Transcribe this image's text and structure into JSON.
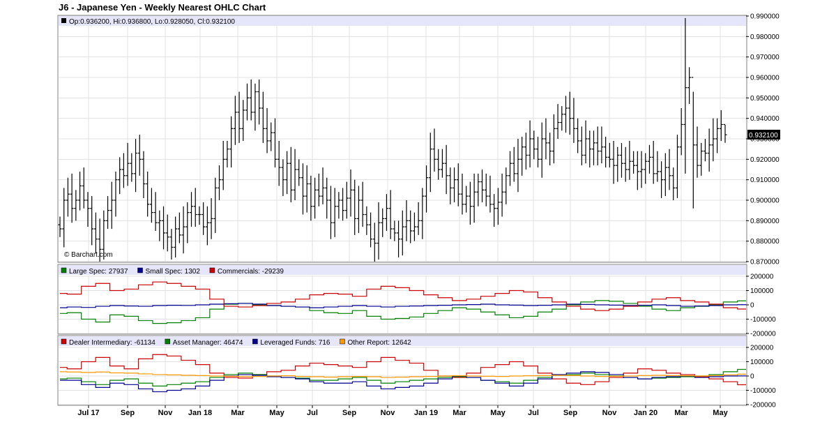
{
  "title": "J6 - Japanese Yen - Weekly Nearest OHLC Chart",
  "watermark": "© Barchart.com",
  "ohlc_legend": "Op:0.936200, Hi:0.936800, Lo:0.928050, Cl:0.932100",
  "last_price_label": "0.932100",
  "colors": {
    "legend_bg": "#e6e6fa",
    "grid": "#e0e0e0",
    "price_bar": "#000000",
    "large_spec": "#008000",
    "small_spec": "#000090",
    "commercials": "#cc0000",
    "dealer": "#cc0000",
    "asset_manager": "#008000",
    "leveraged": "#000090",
    "other_report": "#ff9900"
  },
  "chart_data": [
    {
      "type": "ohlc",
      "title": "J6 - Japanese Yen - Weekly Nearest OHLC Chart",
      "ylim": [
        0.87,
        0.99
      ],
      "y_ticks": [
        "0.990000",
        "0.980000",
        "0.970000",
        "0.960000",
        "0.950000",
        "0.940000",
        "0.930000",
        "0.920000",
        "0.910000",
        "0.900000",
        "0.890000",
        "0.880000",
        "0.870000"
      ],
      "x_ticks": [
        "Jul 17",
        "Sep",
        "Nov",
        "Jan 18",
        "Mar",
        "May",
        "Jul",
        "Sep",
        "Nov",
        "Jan 19",
        "Mar",
        "May",
        "Jul",
        "Sep",
        "Nov",
        "Jan 20",
        "Mar",
        "May"
      ],
      "closes": [
        0.886,
        0.9,
        0.903,
        0.896,
        0.9,
        0.907,
        0.9,
        0.896,
        0.886,
        0.881,
        0.876,
        0.89,
        0.895,
        0.9,
        0.91,
        0.915,
        0.912,
        0.918,
        0.913,
        0.923,
        0.92,
        0.908,
        0.898,
        0.894,
        0.889,
        0.89,
        0.884,
        0.882,
        0.877,
        0.886,
        0.883,
        0.887,
        0.894,
        0.897,
        0.893,
        0.893,
        0.887,
        0.889,
        0.891,
        0.906,
        0.91,
        0.92,
        0.925,
        0.935,
        0.943,
        0.935,
        0.944,
        0.95,
        0.943,
        0.953,
        0.945,
        0.935,
        0.929,
        0.933,
        0.92,
        0.916,
        0.91,
        0.918,
        0.905,
        0.915,
        0.911,
        0.902,
        0.908,
        0.897,
        0.905,
        0.902,
        0.906,
        0.9,
        0.889,
        0.897,
        0.9,
        0.895,
        0.901,
        0.905,
        0.891,
        0.9,
        0.893,
        0.888,
        0.881,
        0.879,
        0.889,
        0.891,
        0.896,
        0.886,
        0.884,
        0.881,
        0.887,
        0.89,
        0.885,
        0.887,
        0.89,
        0.902,
        0.911,
        0.925,
        0.92,
        0.915,
        0.918,
        0.912,
        0.906,
        0.91,
        0.903,
        0.898,
        0.902,
        0.897,
        0.904,
        0.909,
        0.905,
        0.902,
        0.898,
        0.896,
        0.899,
        0.904,
        0.912,
        0.918,
        0.913,
        0.92,
        0.926,
        0.922,
        0.93,
        0.925,
        0.92,
        0.93,
        0.928,
        0.924,
        0.935,
        0.938,
        0.942,
        0.945,
        0.94,
        0.935,
        0.929,
        0.922,
        0.93,
        0.925,
        0.928,
        0.924,
        0.926,
        0.921,
        0.92,
        0.917,
        0.922,
        0.918,
        0.915,
        0.919,
        0.917,
        0.914,
        0.915,
        0.919,
        0.921,
        0.913,
        0.914,
        0.91,
        0.916,
        0.912,
        0.906,
        0.926,
        0.937,
        0.955,
        0.96,
        0.927,
        0.917,
        0.924,
        0.923,
        0.927,
        0.93,
        0.935,
        0.937,
        0.932
      ],
      "last": {
        "open": 0.9362,
        "high": 0.9368,
        "low": 0.92805,
        "close": 0.9321
      }
    },
    {
      "type": "line",
      "title": "",
      "ylim": [
        -200000,
        200000
      ],
      "y_ticks": [
        "200000",
        "100000",
        "0",
        "-100000",
        "-200000"
      ],
      "series": [
        {
          "name": "Large Spec",
          "last": 27937,
          "keys": [
            -60000,
            -55000,
            -100000,
            -120000,
            -70000,
            -80000,
            -110000,
            -130000,
            -125000,
            -110000,
            -90000,
            -30000,
            5000,
            10000,
            0,
            -5000,
            -10000,
            -15000,
            -40000,
            -55000,
            -60000,
            -40000,
            -80000,
            -100000,
            -95000,
            -85000,
            -60000,
            -40000,
            -20000,
            -30000,
            -50000,
            -70000,
            -90000,
            -80000,
            -50000,
            -30000,
            0,
            20000,
            30000,
            25000,
            10000,
            -10000,
            -30000,
            -40000,
            -20000,
            -10000,
            0,
            20000,
            28000
          ]
        },
        {
          "name": "Small Spec",
          "last": 1302,
          "keys": [
            -20000,
            -15000,
            -18000,
            -10000,
            -5000,
            -8000,
            -10000,
            -5000,
            -3000,
            -4000,
            0,
            5000,
            8000,
            10000,
            5000,
            -5000,
            -10000,
            -15000,
            -20000,
            -15000,
            -10000,
            -5000,
            -10000,
            -15000,
            -10000,
            -8000,
            -5000,
            -3000,
            0,
            2000,
            5000,
            0,
            -2000,
            -5000,
            -3000,
            0,
            5000,
            3000,
            0,
            -2000,
            -5000,
            -3000,
            0,
            -5000,
            -10000,
            -8000,
            -5000,
            0,
            1302
          ]
        },
        {
          "name": "Commercials",
          "last": -29239,
          "keys": [
            80000,
            75000,
            130000,
            150000,
            100000,
            110000,
            140000,
            160000,
            150000,
            130000,
            110000,
            40000,
            -10000,
            -15000,
            -5000,
            10000,
            20000,
            40000,
            70000,
            80000,
            75000,
            60000,
            110000,
            130000,
            120000,
            100000,
            70000,
            50000,
            30000,
            40000,
            60000,
            80000,
            100000,
            90000,
            50000,
            20000,
            -10000,
            -30000,
            -40000,
            -30000,
            -10000,
            20000,
            40000,
            50000,
            30000,
            20000,
            5000,
            -20000,
            -29239
          ]
        }
      ]
    },
    {
      "type": "line",
      "title": "",
      "ylim": [
        -200000,
        200000
      ],
      "y_ticks": [
        "200000",
        "100000",
        "0",
        "-100000",
        "-200000"
      ],
      "series": [
        {
          "name": "Dealer Intermediary",
          "last": -61134,
          "keys": [
            60000,
            50000,
            100000,
            130000,
            70000,
            50000,
            120000,
            150000,
            140000,
            110000,
            80000,
            20000,
            -10000,
            -15000,
            10000,
            30000,
            40000,
            70000,
            90000,
            80000,
            70000,
            60000,
            100000,
            130000,
            110000,
            90000,
            40000,
            0,
            -10000,
            20000,
            60000,
            80000,
            100000,
            70000,
            20000,
            -20000,
            -50000,
            -60000,
            -40000,
            -10000,
            20000,
            50000,
            40000,
            20000,
            10000,
            -5000,
            -20000,
            -40000,
            -61134
          ]
        },
        {
          "name": "Asset Manager",
          "last": 46474,
          "keys": [
            -20000,
            -15000,
            -40000,
            -60000,
            -30000,
            -20000,
            -50000,
            -70000,
            -60000,
            -50000,
            -40000,
            -10000,
            10000,
            20000,
            10000,
            0,
            -10000,
            -15000,
            -30000,
            -30000,
            -20000,
            -10000,
            -30000,
            -50000,
            -40000,
            -30000,
            -20000,
            -10000,
            -5000,
            -10000,
            -30000,
            -40000,
            -50000,
            -30000,
            -10000,
            5000,
            10000,
            20000,
            10000,
            0,
            -10000,
            -20000,
            -15000,
            -10000,
            -5000,
            0,
            10000,
            30000,
            46474
          ]
        },
        {
          "name": "Leveraged Funds",
          "last": 716,
          "keys": [
            -30000,
            -30000,
            -60000,
            -80000,
            -50000,
            -60000,
            -90000,
            -110000,
            -100000,
            -90000,
            -70000,
            -30000,
            0,
            10000,
            5000,
            -5000,
            -10000,
            -20000,
            -40000,
            -50000,
            -50000,
            -40000,
            -70000,
            -90000,
            -80000,
            -70000,
            -50000,
            -20000,
            0,
            -10000,
            -30000,
            -50000,
            -70000,
            -50000,
            -20000,
            10000,
            20000,
            30000,
            25000,
            10000,
            -10000,
            -20000,
            -10000,
            -5000,
            0,
            -10000,
            -5000,
            0,
            716
          ]
        },
        {
          "name": "Other Report",
          "last": 12642,
          "keys": [
            30000,
            28000,
            25000,
            28000,
            22000,
            20000,
            15000,
            10000,
            8000,
            5000,
            3000,
            0,
            -2000,
            -5000,
            -3000,
            0,
            2000,
            -3000,
            -5000,
            -8000,
            -5000,
            -3000,
            -5000,
            -10000,
            -8000,
            -5000,
            -3000,
            0,
            2000,
            0,
            -2000,
            -3000,
            0,
            2000,
            3000,
            5000,
            3000,
            0,
            -3000,
            -2000,
            0,
            3000,
            5000,
            3000,
            2000,
            0,
            3000,
            8000,
            12642
          ]
        }
      ]
    }
  ]
}
